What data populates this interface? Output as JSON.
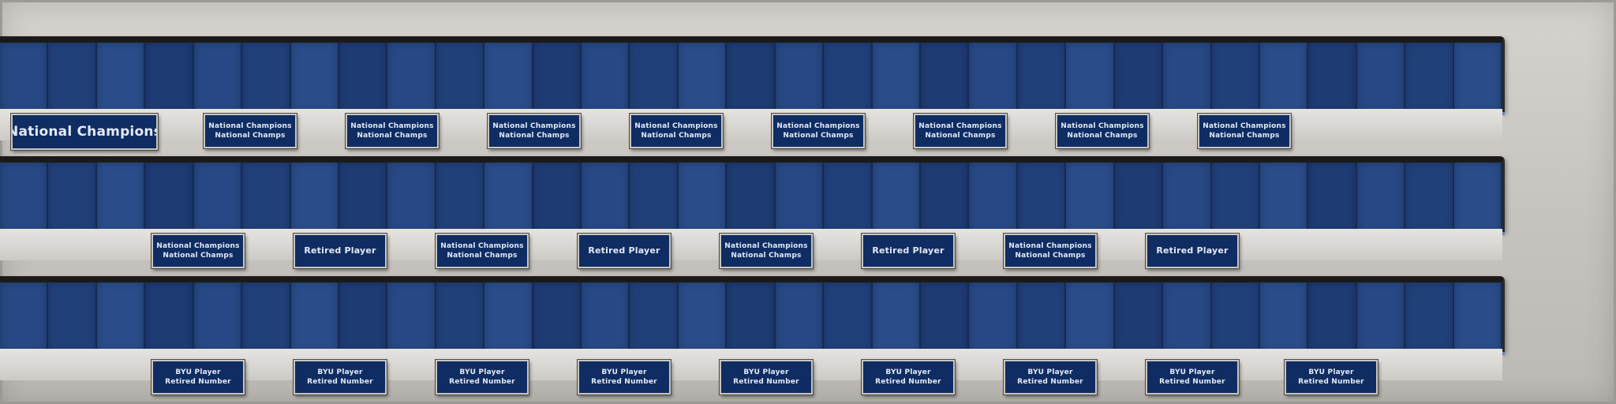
{
  "colors": {
    "wall": "#c9c6c1",
    "banner_panel": "#23417b",
    "plaque_bg": "#0f2d63",
    "plaque_text": "#e4e9f5"
  },
  "rows": [
    {
      "plaques": [
        {
          "lines": [
            "National Champions"
          ]
        },
        {
          "lines": [
            "National Champions",
            "National Champs"
          ]
        },
        {
          "lines": [
            "National Champions",
            "National Champs"
          ]
        },
        {
          "lines": [
            "National Champions",
            "National Champs"
          ]
        },
        {
          "lines": [
            "National Champions",
            "National Champs"
          ]
        },
        {
          "lines": [
            "National Champions",
            "National Champs"
          ]
        },
        {
          "lines": [
            "National Champions",
            "National Champs"
          ]
        },
        {
          "lines": [
            "National Champions",
            "National Champs"
          ]
        },
        {
          "lines": [
            "National Champions",
            "National Champs"
          ]
        }
      ]
    },
    {
      "plaques": [
        {
          "lines": [
            "National Champions",
            "National Champs"
          ]
        },
        {
          "lines": [
            "Retired Player"
          ]
        },
        {
          "lines": [
            "National Champions",
            "National Champs"
          ]
        },
        {
          "lines": [
            "Retired Player"
          ]
        },
        {
          "lines": [
            "National Champions",
            "National Champs"
          ]
        },
        {
          "lines": [
            "Retired Player"
          ]
        },
        {
          "lines": [
            "National Champions",
            "National Champs"
          ]
        },
        {
          "lines": [
            "Retired Player"
          ]
        }
      ]
    },
    {
      "plaques": [
        {
          "lines": [
            "BYU Player",
            "Retired Number"
          ]
        },
        {
          "lines": [
            "BYU Player",
            "Retired Number"
          ]
        },
        {
          "lines": [
            "BYU Player",
            "Retired Number"
          ]
        },
        {
          "lines": [
            "BYU Player",
            "Retired Number"
          ]
        },
        {
          "lines": [
            "BYU Player",
            "Retired Number"
          ]
        },
        {
          "lines": [
            "BYU Player",
            "Retired Number"
          ]
        },
        {
          "lines": [
            "BYU Player",
            "Retired Number"
          ]
        },
        {
          "lines": [
            "BYU Player",
            "Retired Number"
          ]
        },
        {
          "lines": [
            "BYU Player",
            "Retired Number"
          ]
        }
      ]
    }
  ]
}
